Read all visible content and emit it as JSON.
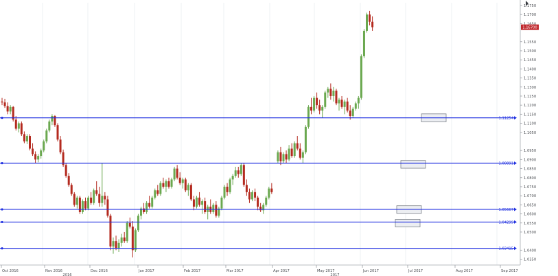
{
  "chart_data": {
    "type": "candlestick",
    "instrument_note": "",
    "y_axis": {
      "ylim": [
        1.0318,
        1.1765
      ],
      "ticks": [
        {
          "value": 1.175,
          "label": "1.1750"
        },
        {
          "value": 1.17,
          "label": "1.1700"
        },
        {
          "value": 1.165,
          "label": "1.1650"
        },
        {
          "value": 1.155,
          "label": "1.1550"
        },
        {
          "value": 1.15,
          "label": "1.1500"
        },
        {
          "value": 1.145,
          "label": "1.1450"
        },
        {
          "value": 1.14,
          "label": "1.1400"
        },
        {
          "value": 1.135,
          "label": "1.1350"
        },
        {
          "value": 1.13,
          "label": "1.1300"
        },
        {
          "value": 1.125,
          "label": "1.1250"
        },
        {
          "value": 1.12,
          "label": "1.1200"
        },
        {
          "value": 1.115,
          "label": "1.1150"
        },
        {
          "value": 1.11,
          "label": "1.1100"
        },
        {
          "value": 1.105,
          "label": "1.1050"
        },
        {
          "value": 1.095,
          "label": "1.0950"
        },
        {
          "value": 1.09,
          "label": "1.0900"
        },
        {
          "value": 1.085,
          "label": "1.0850"
        },
        {
          "value": 1.08,
          "label": "1.0800"
        },
        {
          "value": 1.075,
          "label": "1.0750"
        },
        {
          "value": 1.07,
          "label": "1.0700"
        },
        {
          "value": 1.065,
          "label": "1.0650"
        },
        {
          "value": 1.06,
          "label": "1.0600"
        },
        {
          "value": 1.055,
          "label": "1.0550"
        },
        {
          "value": 1.05,
          "label": "1.0500"
        },
        {
          "value": 1.04,
          "label": "1.0400"
        },
        {
          "value": 1.035,
          "label": "1.0350"
        }
      ]
    },
    "current_price": {
      "value": 1.163,
      "label": "1.16700",
      "color": "#c0282d"
    },
    "x_axis": {
      "labels": [
        "Oct 2016",
        "Nov 2016",
        "Dec 2016",
        "Jan 2017",
        "Feb 2017",
        "Mar 2017",
        "Apr 2017",
        "May 2017",
        "Jun 2017",
        "Jul 2017",
        "Aug 2017",
        "Sep 2017"
      ],
      "year_labels": [
        "2016",
        "2017"
      ]
    },
    "levels": [
      {
        "value": 1.113,
        "label": "1.11254"
      },
      {
        "value": 1.088,
        "label": "1.08891"
      },
      {
        "value": 1.0625,
        "label": "1.05667"
      },
      {
        "value": 1.0555,
        "label": "1.04299"
      },
      {
        "value": 1.041,
        "label": "1.03415"
      }
    ],
    "zones": [
      {
        "level": 1.113,
        "top": 1.1152,
        "bottom": 1.1108
      },
      {
        "level": 1.088,
        "top": 1.0895,
        "bottom": 1.0852
      },
      {
        "level": 1.0625,
        "top": 1.0645,
        "bottom": 1.0603
      },
      {
        "level": 1.0555,
        "top": 1.057,
        "bottom": 1.0528
      }
    ],
    "colors": {
      "bull": "#6aa84f",
      "bear": "#b42a1f",
      "level": "#1f2fe0",
      "zone_fill": "#eceef2",
      "zone_stroke": "#7a7f88"
    },
    "candles": [
      [
        1.122,
        1.124,
        1.12,
        1.1215
      ],
      [
        1.1215,
        1.1235,
        1.1185,
        1.1195
      ],
      [
        1.1195,
        1.1215,
        1.115,
        1.1165
      ],
      [
        1.1165,
        1.12,
        1.115,
        1.119
      ],
      [
        1.119,
        1.1195,
        1.111,
        1.112
      ],
      [
        1.112,
        1.114,
        1.106,
        1.107
      ],
      [
        1.107,
        1.111,
        1.105,
        1.11
      ],
      [
        1.11,
        1.111,
        1.103,
        1.104
      ],
      [
        1.104,
        1.1055,
        1.099,
        1.1
      ],
      [
        1.1,
        1.104,
        1.0985,
        1.103
      ],
      [
        1.103,
        1.104,
        1.095,
        1.096
      ],
      [
        1.096,
        1.099,
        1.092,
        1.093
      ],
      [
        1.093,
        1.0945,
        1.088,
        1.09
      ],
      [
        1.09,
        1.093,
        1.0885,
        1.092
      ],
      [
        1.092,
        1.096,
        1.0905,
        1.095
      ],
      [
        1.095,
        1.101,
        1.094,
        1.1
      ],
      [
        1.1,
        1.107,
        1.099,
        1.106
      ],
      [
        1.106,
        1.112,
        1.105,
        1.111
      ],
      [
        1.111,
        1.115,
        1.109,
        1.114
      ],
      [
        1.114,
        1.1145,
        1.108,
        1.109
      ],
      [
        1.109,
        1.11,
        1.1,
        1.101
      ],
      [
        1.101,
        1.103,
        1.093,
        1.094
      ],
      [
        1.094,
        1.0955,
        1.086,
        1.087
      ],
      [
        1.087,
        1.088,
        1.08,
        1.081
      ],
      [
        1.081,
        1.0825,
        1.075,
        1.076
      ],
      [
        1.076,
        1.077,
        1.07,
        1.071
      ],
      [
        1.071,
        1.072,
        1.064,
        1.065
      ],
      [
        1.065,
        1.07,
        1.063,
        1.069
      ],
      [
        1.069,
        1.07,
        1.06,
        1.061
      ],
      [
        1.061,
        1.068,
        1.06,
        1.067
      ],
      [
        1.067,
        1.069,
        1.062,
        1.063
      ],
      [
        1.063,
        1.07,
        1.062,
        1.069
      ],
      [
        1.069,
        1.072,
        1.065,
        1.066
      ],
      [
        1.066,
        1.074,
        1.065,
        1.073
      ],
      [
        1.073,
        1.078,
        1.07,
        1.071
      ],
      [
        1.071,
        1.075,
        1.064,
        1.066
      ],
      [
        1.066,
        1.088,
        1.064,
        1.07
      ],
      [
        1.07,
        1.072,
        1.065,
        1.068
      ],
      [
        1.068,
        1.07,
        1.058,
        1.059
      ],
      [
        1.059,
        1.06,
        1.04,
        1.042
      ],
      [
        1.042,
        1.047,
        1.038,
        1.045
      ],
      [
        1.045,
        1.048,
        1.04,
        1.041
      ],
      [
        1.041,
        1.046,
        1.039,
        1.044
      ],
      [
        1.044,
        1.049,
        1.042,
        1.047
      ],
      [
        1.047,
        1.05,
        1.044,
        1.045
      ],
      [
        1.045,
        1.056,
        1.044,
        1.055
      ],
      [
        1.055,
        1.058,
        1.052,
        1.053
      ],
      [
        1.053,
        1.056,
        1.036,
        1.04
      ],
      [
        1.04,
        1.052,
        1.039,
        1.051
      ],
      [
        1.051,
        1.06,
        1.05,
        1.059
      ],
      [
        1.059,
        1.064,
        1.057,
        1.063
      ],
      [
        1.063,
        1.066,
        1.06,
        1.061
      ],
      [
        1.061,
        1.067,
        1.06,
        1.066
      ],
      [
        1.066,
        1.07,
        1.063,
        1.064
      ],
      [
        1.064,
        1.07,
        1.063,
        1.069
      ],
      [
        1.069,
        1.074,
        1.068,
        1.073
      ],
      [
        1.073,
        1.076,
        1.07,
        1.071
      ],
      [
        1.071,
        1.078,
        1.07,
        1.077
      ],
      [
        1.077,
        1.08,
        1.074,
        1.075
      ],
      [
        1.075,
        1.079,
        1.072,
        1.078
      ],
      [
        1.078,
        1.08,
        1.074,
        1.075
      ],
      [
        1.075,
        1.08,
        1.074,
        1.079
      ],
      [
        1.079,
        1.086,
        1.078,
        1.085
      ],
      [
        1.085,
        1.087,
        1.079,
        1.08
      ],
      [
        1.08,
        1.083,
        1.076,
        1.077
      ],
      [
        1.077,
        1.08,
        1.074,
        1.079
      ],
      [
        1.079,
        1.08,
        1.072,
        1.073
      ],
      [
        1.073,
        1.077,
        1.07,
        1.076
      ],
      [
        1.076,
        1.077,
        1.067,
        1.068
      ],
      [
        1.068,
        1.07,
        1.062,
        1.064
      ],
      [
        1.064,
        1.07,
        1.063,
        1.069
      ],
      [
        1.069,
        1.072,
        1.064,
        1.065
      ],
      [
        1.065,
        1.068,
        1.06,
        1.067
      ],
      [
        1.067,
        1.069,
        1.06,
        1.061
      ],
      [
        1.061,
        1.065,
        1.057,
        1.064
      ],
      [
        1.064,
        1.068,
        1.06,
        1.061
      ],
      [
        1.061,
        1.066,
        1.06,
        1.065
      ],
      [
        1.065,
        1.067,
        1.058,
        1.059
      ],
      [
        1.059,
        1.064,
        1.058,
        1.063
      ],
      [
        1.063,
        1.07,
        1.062,
        1.069
      ],
      [
        1.069,
        1.076,
        1.068,
        1.075
      ],
      [
        1.075,
        1.077,
        1.07,
        1.072
      ],
      [
        1.072,
        1.08,
        1.071,
        1.079
      ],
      [
        1.079,
        1.082,
        1.076,
        1.081
      ],
      [
        1.081,
        1.086,
        1.08,
        1.084
      ],
      [
        1.084,
        1.086,
        1.08,
        1.082
      ],
      [
        1.082,
        1.088,
        1.081,
        1.087
      ],
      [
        1.087,
        1.088,
        1.075,
        1.076
      ],
      [
        1.076,
        1.079,
        1.07,
        1.072
      ],
      [
        1.072,
        1.074,
        1.066,
        1.068
      ],
      [
        1.068,
        1.073,
        1.067,
        1.072
      ],
      [
        1.072,
        1.074,
        1.067,
        1.069
      ],
      [
        1.069,
        1.07,
        1.062,
        1.064
      ],
      [
        1.064,
        1.066,
        1.061,
        1.062
      ],
      [
        1.062,
        1.066,
        1.06,
        1.065
      ],
      [
        1.065,
        1.07,
        1.064,
        1.069
      ],
      [
        1.069,
        1.075,
        1.068,
        1.074
      ],
      [
        1.074,
        1.077,
        1.071,
        1.072
      ],
      [
        1.089,
        1.095,
        1.088,
        1.094
      ],
      [
        1.094,
        1.097,
        1.087,
        1.089
      ],
      [
        1.089,
        1.094,
        1.088,
        1.093
      ],
      [
        1.093,
        1.095,
        1.088,
        1.09
      ],
      [
        1.09,
        1.098,
        1.089,
        1.096
      ],
      [
        1.096,
        1.099,
        1.091,
        1.092
      ],
      [
        1.092,
        1.1,
        1.091,
        1.099
      ],
      [
        1.099,
        1.103,
        1.095,
        1.096
      ],
      [
        1.096,
        1.099,
        1.09,
        1.091
      ],
      [
        1.091,
        1.095,
        1.088,
        1.094
      ],
      [
        1.094,
        1.109,
        1.093,
        1.108
      ],
      [
        1.108,
        1.12,
        1.107,
        1.119
      ],
      [
        1.119,
        1.124,
        1.115,
        1.117
      ],
      [
        1.117,
        1.125,
        1.116,
        1.124
      ],
      [
        1.124,
        1.127,
        1.118,
        1.12
      ],
      [
        1.12,
        1.123,
        1.115,
        1.117
      ],
      [
        1.117,
        1.12,
        1.113,
        1.119
      ],
      [
        1.119,
        1.128,
        1.118,
        1.127
      ],
      [
        1.127,
        1.13,
        1.124,
        1.129
      ],
      [
        1.129,
        1.132,
        1.123,
        1.125
      ],
      [
        1.125,
        1.13,
        1.122,
        1.128
      ],
      [
        1.128,
        1.129,
        1.12,
        1.121
      ],
      [
        1.121,
        1.124,
        1.117,
        1.123
      ],
      [
        1.123,
        1.125,
        1.118,
        1.119
      ],
      [
        1.119,
        1.123,
        1.115,
        1.122
      ],
      [
        1.122,
        1.124,
        1.116,
        1.117
      ],
      [
        1.117,
        1.12,
        1.112,
        1.114
      ],
      [
        1.114,
        1.119,
        1.113,
        1.118
      ],
      [
        1.118,
        1.122,
        1.117,
        1.121
      ],
      [
        1.121,
        1.125,
        1.118,
        1.124
      ],
      [
        1.124,
        1.148,
        1.123,
        1.147
      ],
      [
        1.147,
        1.162,
        1.146,
        1.161
      ],
      [
        1.161,
        1.171,
        1.16,
        1.17
      ],
      [
        1.17,
        1.172,
        1.164,
        1.166
      ],
      [
        1.166,
        1.169,
        1.161,
        1.163
      ]
    ]
  }
}
